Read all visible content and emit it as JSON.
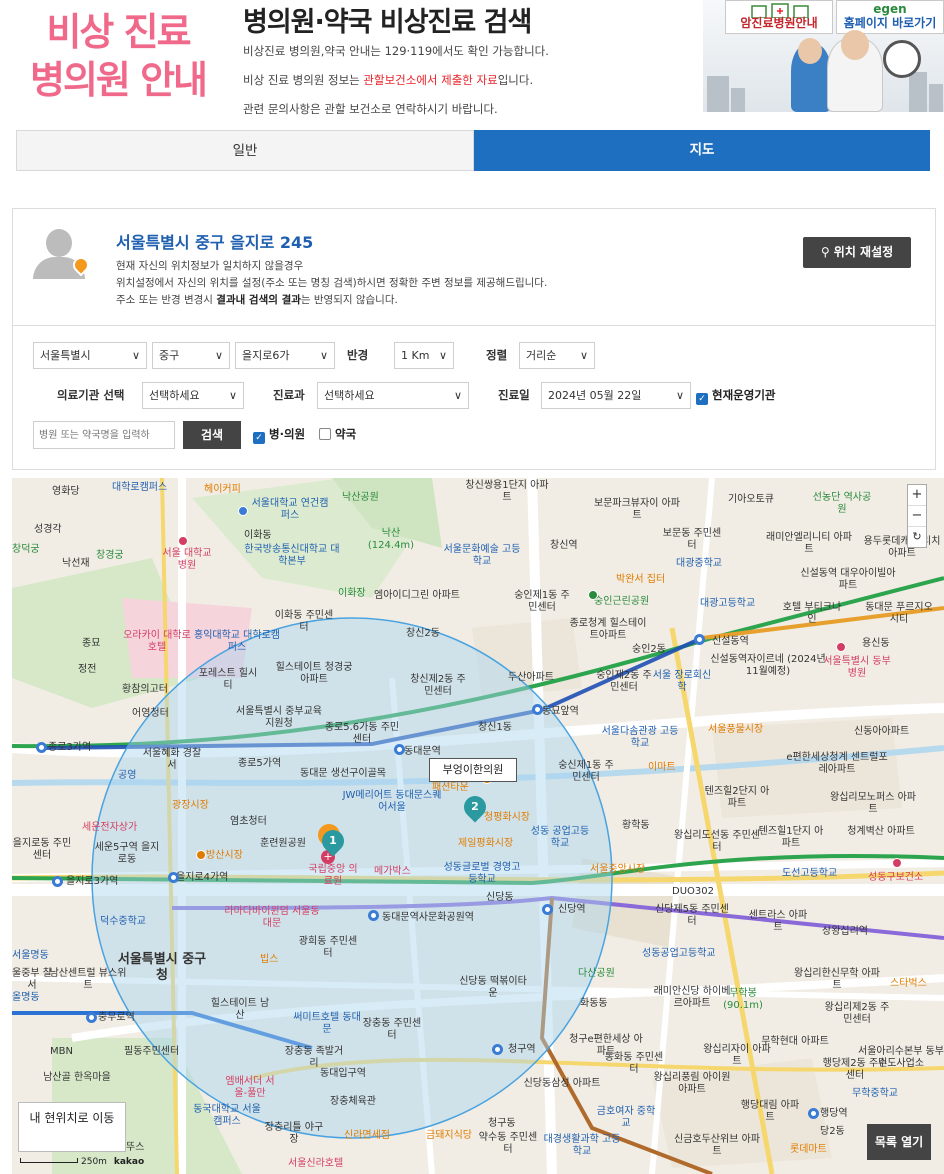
{
  "header": {
    "logo_line1": "비상 진료",
    "logo_line2": "병의원 안내",
    "title": "병의원·약국 비상진료 검색",
    "line1": "비상진료 병의원,약국 안내는 129·119에서도 확인 가능합니다.",
    "line2_prefix": "비상 진료 병의원 정보는 ",
    "line2_highlight": "관할보건소에서 제출한 자료",
    "line2_suffix": "입니다.",
    "line3": "관련 문의사항은 관할 보건소로 연락하시기 바랍니다.",
    "banner_cancer": "암진료병원안내",
    "banner_egen_logo": "egen",
    "banner_homepage": "홈페이지 바로가기"
  },
  "tabs": {
    "normal": "일반",
    "map": "지도"
  },
  "location": {
    "address": "서울특별시 중구 을지로 245",
    "info1": "현재 자신의 위치정보가 일치하지 않을경우",
    "info2": "위치설정에서 자신의 위치를 설정(주소 또는 명칭 검색)하시면 정확한 주변 정보를 제공해드립니다.",
    "info3_prefix": "주소 또는 반경 변경시 ",
    "info3_bold": "결과내 검색의 결과",
    "info3_suffix": "는 반영되지 않습니다.",
    "reset_button": "위치 재설정"
  },
  "search": {
    "sido": "서울특별시",
    "sigungu": "중구",
    "dong": "을지로6가",
    "radius_label": "반경",
    "radius": "1 Km",
    "sort_label": "정렬",
    "sort": "거리순",
    "facility_label": "의료기관 선택",
    "facility": "선택하세요",
    "dept_label": "진료과",
    "dept": "선택하세요",
    "date_label": "진료일",
    "date": "2024년 05월 22일",
    "open_now": "현재운영기관",
    "name_placeholder": "병원 또는 약국명을 입력하",
    "search_button": "검색",
    "hospital_check": "병·의원",
    "pharmacy_check": "약국"
  },
  "map": {
    "tooltip": "부엉이한의원",
    "marker1": "1",
    "marker2": "2",
    "zoom_in": "+",
    "zoom_out": "−",
    "reset_icon": "↻",
    "my_location_button": "내 현위치로 이동",
    "list_button": "목록 열기",
    "scale": "250m",
    "kakao": "kakao",
    "labels": {
      "l1": "대학로캠퍼스",
      "l2": "헤이커피",
      "l3": "서울대학교 연건캠퍼스",
      "l4": "낙산공원",
      "l5": "창신쌍용1단지 아파트",
      "l6": "보문파크뷰자이 아파트",
      "l7": "기아오토큐",
      "l8": "선농단 역사공원",
      "l9": "영화당",
      "l10": "성경각",
      "l11": "창덕궁",
      "l12": "창경궁",
      "l13": "낙선재",
      "l14": "서울 대학교병원",
      "l15": "한국방송통신대학교 대학본부",
      "l16": "이화동",
      "l17": "낙산 (124.4m)",
      "l18": "서울문화예술 고등학교",
      "l19": "창신역",
      "l20": "보문동 주민센터",
      "l21": "래미안엘리니티 아파트",
      "l22": "용두롯데캐슬 리치아파트",
      "l23": "대광중학교",
      "l24": "박완서 집터",
      "l25": "신설동역 대우아이빌아파트",
      "l26": "이화장",
      "l27": "엠아이디그린 아파트",
      "l28": "숭인제1동 주민센터",
      "l29": "숭인근린공원",
      "l30": "대광고등학교",
      "l31": "호텔 부티크나인",
      "l32": "동대문 푸르지오시티",
      "l33": "이화동 주민센터",
      "l34": "종로청계 힐스테이트아파트",
      "l35": "창신2동",
      "l36": "종묘",
      "l37": "오라카이 대학로호텔",
      "l38": "홍익대학교 대학로캠퍼스",
      "l39": "숭인2동",
      "l40": "신설동역",
      "l41": "용신동",
      "l42": "서울특별시 동부병원",
      "l43": "정전",
      "l44": "포레스트 힐시티",
      "l45": "힐스테이트 청경궁아파트",
      "l46": "창신제2동 주민센터",
      "l47": "두산아파트",
      "l48": "숭인제2동 주민센터",
      "l49": "서울 장로회신학",
      "l50": "신설동역자이르네 (2024년11월예정)",
      "l51": "황참의고터",
      "l52": "동묘앞역",
      "l53": "어영청터",
      "l54": "서울특별시 중부교육지원청",
      "l55": "종로5.6가동 주민센터",
      "l56": "창신1동",
      "l57": "서울다솜관광 고등학교",
      "l58": "서울풍물시장",
      "l59": "신동아아파트",
      "l60": "종로3가역",
      "l61": "서울혜화 경찰서",
      "l62": "종로5가역",
      "l63": "동대문역",
      "l64": "동대문 생선구이골목",
      "l65": "숭신제1동 주민센터",
      "l66": "이마트",
      "l67": "e편한세상청계 센트럴포레아파트",
      "l68": "공영",
      "l69": "광장시장",
      "l70": "JW메리어트 동대문스퀘어서울",
      "l71": "패션타운",
      "l72": "텐즈힐2단지 아파트",
      "l73": "왕십리모노퍼스 아파트",
      "l74": "세운전자상가",
      "l75": "염초청터",
      "l76": "청평화시장",
      "l77": "황학동",
      "l78": "왕십리도선동 주민센터",
      "l79": "텐즈힐1단지 아파트",
      "l80": "청계벽산 아파트",
      "l81": "을지로동 주민센터",
      "l82": "세운5구역 을지로동",
      "l83": "훈련원공원",
      "l84": "제일평화시장",
      "l85": "성동 공업고등학교",
      "l86": "방산시장",
      "l87": "국립중앙 의료원",
      "l88": "메가박스",
      "l89": "성동글로벌 경영고등학교",
      "l90": "서울중앙시장",
      "l91": "도선고등학교",
      "l92": "성동구보건소",
      "l93": "을지로3가역",
      "l94": "을지로4가역",
      "l95": "신당동",
      "l96": "DUO302",
      "l97": "덕수중학교",
      "l98": "라마다바이윈덤 서울동대문",
      "l99": "동대문역사문화공원역",
      "l100": "신당역",
      "l101": "신당제5동 주민센터",
      "l102": "센트라스 아파트",
      "l103": "상왕십리역",
      "l104": "서울명동",
      "l105": "광희동 주민센터",
      "l106": "성동공업고등학교",
      "l107": "서울특별시 중구청",
      "l108": "남산센트럴 뷰스위트",
      "l109": "빕스",
      "l110": "다산공원",
      "l111": "신당동 떡볶이타운",
      "l112": "왕십리한신무학 아파트",
      "l113": "스타벅스",
      "l114": "울중부 찰서",
      "l115": "올명동",
      "l116": "래미안신당 하이베르아파트",
      "l117": "무학봉 (90.1m)",
      "l118": "왕십리제2동 주민센터",
      "l119": "힐스테이트 남산",
      "l120": "써미트호텔 동대문",
      "l121": "장충동 주민센터",
      "l122": "충무로역",
      "l123": "화동동",
      "l124": "MBN",
      "l125": "필동주민센터",
      "l126": "장충동 족발거리",
      "l127": "청구역",
      "l128": "청구e편한세상 아파트",
      "l129": "동화동 주민센터",
      "l130": "왕십리자이 아파트",
      "l131": "무학현대 아파트",
      "l132": "행당제2동 주민센터",
      "l133": "서울아리수본부 동부수도사업소",
      "l134": "남산골 한옥마을",
      "l135": "엠배서더 서울-풀만",
      "l136": "동대입구역",
      "l137": "신당동삼성 아파트",
      "l138": "왕십리풍림 아이원아파트",
      "l139": "무학중학교",
      "l140": "행당대림 아파트",
      "l141": "행당역",
      "l142": "동국대학교 서울캠퍼스",
      "l143": "장충리틀 야구장",
      "l144": "장충체육관",
      "l145": "신라면세점",
      "l146": "금돼지식당",
      "l147": "금호여자 중학교",
      "l148": "약수동 주민센터",
      "l149": "대경생활과학 고등학교",
      "l150": "신금호두산위브 아파트",
      "l151": "당2동",
      "l152": "롯데마트",
      "l153": "서울신라호텔",
      "l154": "뚜스",
      "l155": "청구동"
    }
  },
  "colors": {
    "accent": "#1f6fc1",
    "logo_pink": "#f0698a",
    "highlight_red": "#e8232a",
    "address_blue": "#1f5fb0",
    "dark_button": "#444444",
    "radius_fill": "#a9d4f0"
  }
}
